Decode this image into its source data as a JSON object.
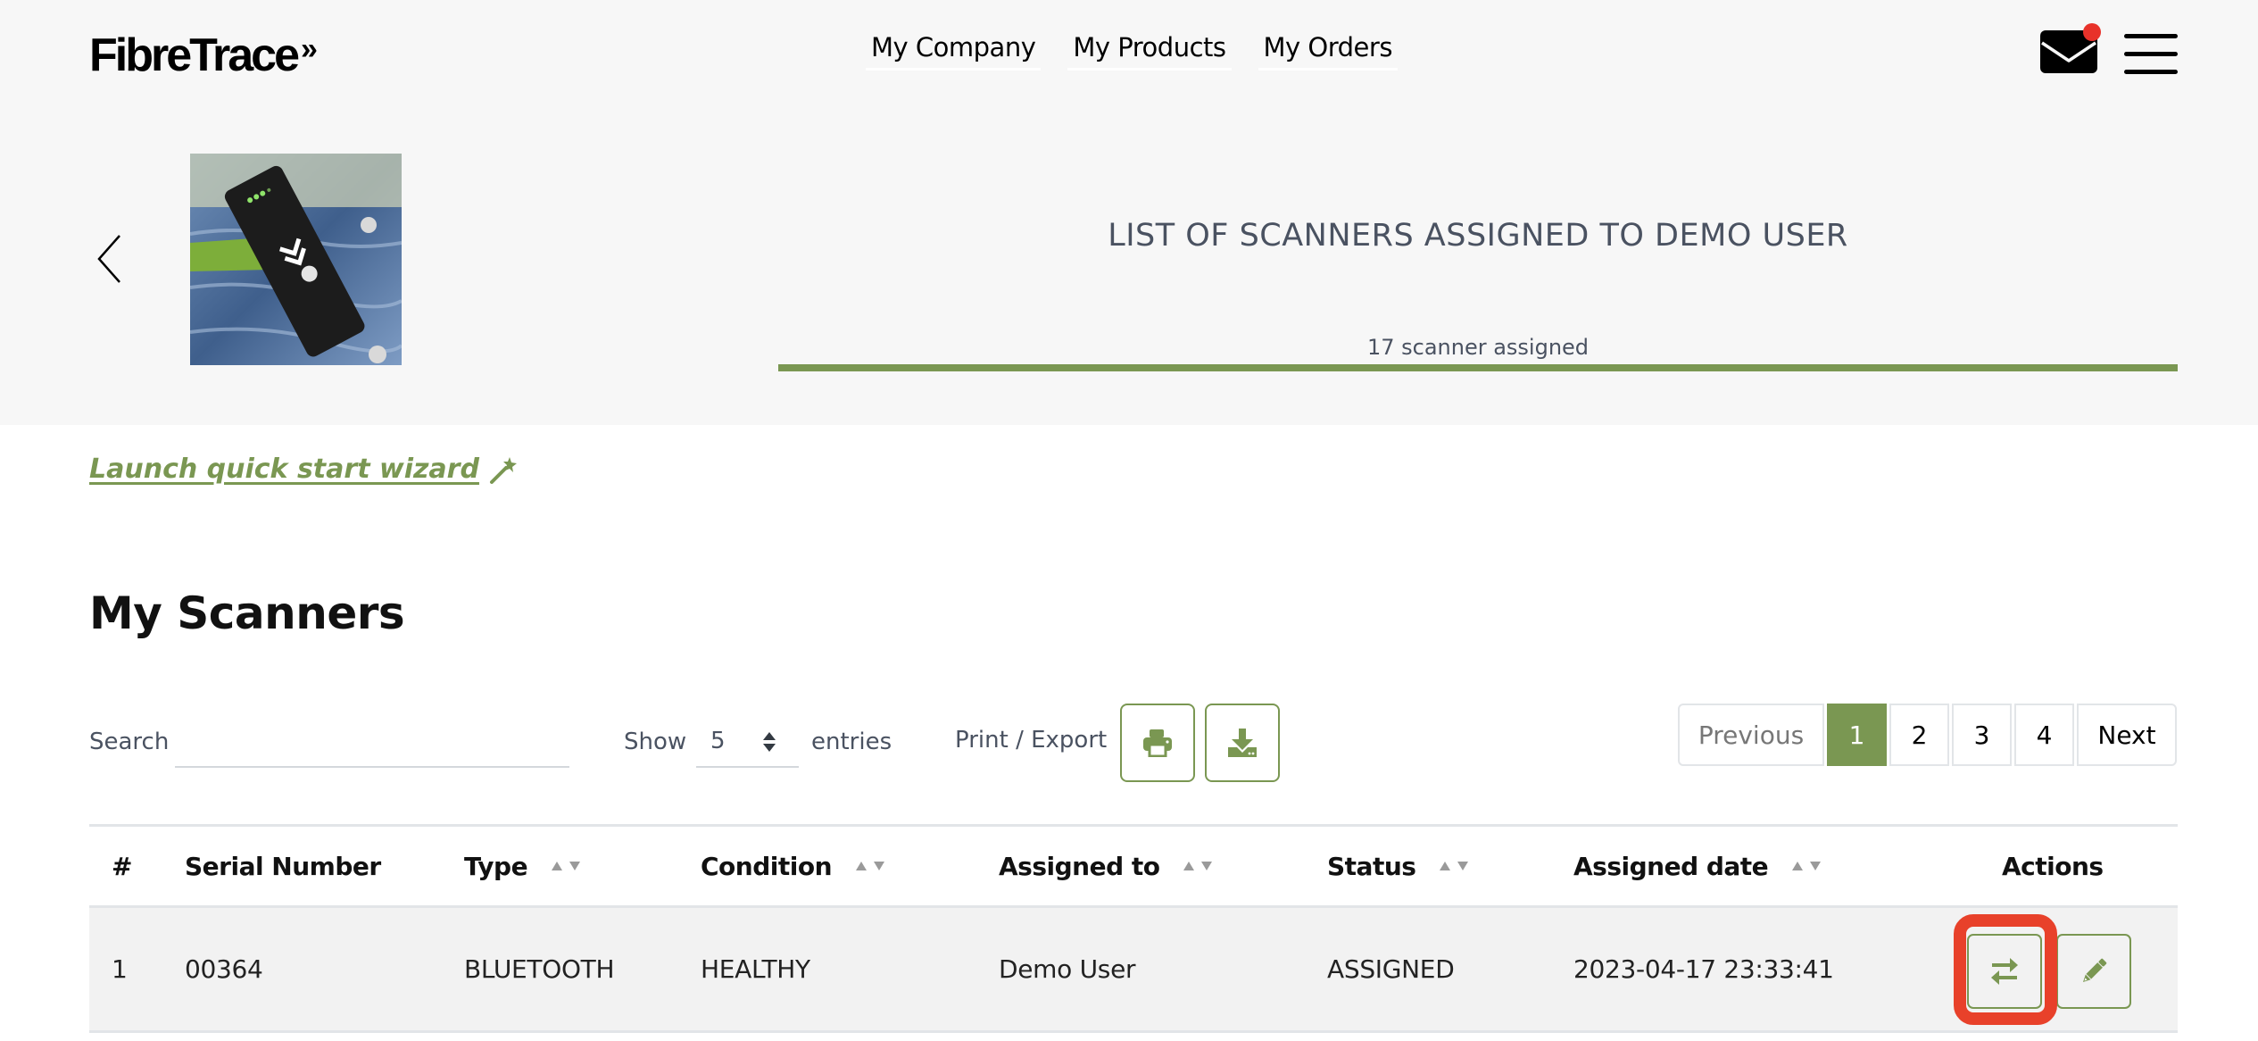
{
  "brand": {
    "name": "FibreTrace",
    "mark": "»",
    "accent_color": "#7a9752",
    "notification_color": "#e8322a"
  },
  "nav": {
    "items": [
      {
        "label": "My Company"
      },
      {
        "label": "My Products"
      },
      {
        "label": "My Orders"
      }
    ],
    "mail_icon": "envelope-icon",
    "menu_icon": "hamburger-menu-icon",
    "has_notification": true
  },
  "hero": {
    "title": "LIST OF SCANNERS ASSIGNED TO DEMO USER",
    "assigned_text": "17 scanner assigned",
    "progress_fraction": 1.0,
    "image_alt": "FibreTrace scanner on denim"
  },
  "wizard": {
    "label": "Launch quick start wizard",
    "icon": "magic-wand-icon"
  },
  "section": {
    "title": "My Scanners"
  },
  "controls": {
    "search_label": "Search",
    "search_value": "",
    "show_label": "Show",
    "entries_value": "5",
    "entries_label": "entries",
    "export_label": "Print / Export",
    "print_icon": "print-icon",
    "download_icon": "download-icon"
  },
  "pagination": {
    "previous": "Previous",
    "pages": [
      "1",
      "2",
      "3",
      "4"
    ],
    "active_page": "1",
    "next": "Next"
  },
  "table": {
    "columns": [
      {
        "label": "#",
        "sortable": false
      },
      {
        "label": "Serial Number",
        "sortable": false
      },
      {
        "label": "Type",
        "sortable": true
      },
      {
        "label": "Condition",
        "sortable": true
      },
      {
        "label": "Assigned to",
        "sortable": true
      },
      {
        "label": "Status",
        "sortable": true
      },
      {
        "label": "Assigned date",
        "sortable": true
      },
      {
        "label": "Actions",
        "sortable": false
      }
    ],
    "rows": [
      {
        "index": "1",
        "serial": "00364",
        "type": "BLUETOOTH",
        "condition": "HEALTHY",
        "assigned_to": "Demo User",
        "status": "ASSIGNED",
        "assigned_date": "2023-04-17 23:33:41",
        "actions": [
          "transfer",
          "edit"
        ]
      }
    ]
  }
}
